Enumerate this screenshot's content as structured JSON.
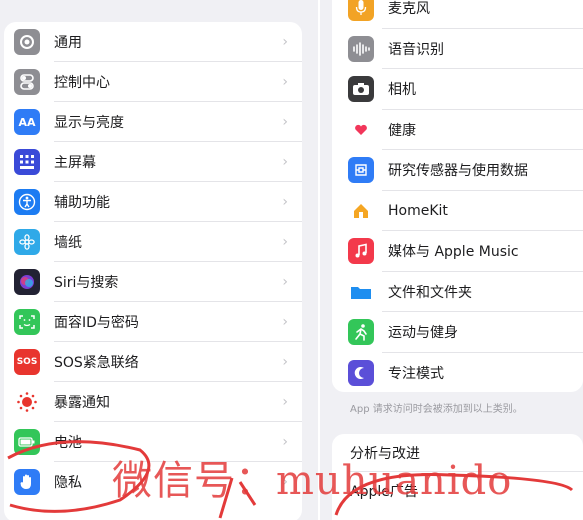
{
  "left_items": [
    {
      "label": "通用",
      "icon": "gear-icon",
      "color": "#8e8e93"
    },
    {
      "label": "控制中心",
      "icon": "toggle-icon",
      "color": "#8e8e93"
    },
    {
      "label": "显示与亮度",
      "icon": "aa-icon",
      "glyph": "AA",
      "color": "#2f7cf6"
    },
    {
      "label": "主屏幕",
      "icon": "grid-icon",
      "color": "#3a4ad8"
    },
    {
      "label": "辅助功能",
      "icon": "accessibility-icon",
      "color": "#1d7cf2"
    },
    {
      "label": "墙纸",
      "icon": "flower-icon",
      "color": "#2fa9e8"
    },
    {
      "label": "Siri与搜索",
      "icon": "siri-icon",
      "color": "#222233"
    },
    {
      "label": "面容ID与密码",
      "icon": "faceid-icon",
      "color": "#33c659"
    },
    {
      "label": "SOS紧急联络",
      "icon": "sos-icon",
      "glyph": "SOS",
      "color": "#e8352e"
    },
    {
      "label": "暴露通知",
      "icon": "exposure-icon",
      "color": "#ffffff"
    },
    {
      "label": "电池",
      "icon": "battery-icon",
      "color": "#33c659"
    },
    {
      "label": "隐私",
      "icon": "hand-icon",
      "color": "#2f7cf6"
    }
  ],
  "right_items": [
    {
      "label": "麦克风",
      "icon": "microphone-icon",
      "color": "#f2a325"
    },
    {
      "label": "语音识别",
      "icon": "waveform-icon",
      "color": "#8e8e93"
    },
    {
      "label": "相机",
      "icon": "camera-icon",
      "color": "#3a3a3c"
    },
    {
      "label": "健康",
      "icon": "heart-icon",
      "color": "#ffffff"
    },
    {
      "label": "研究传感器与使用数据",
      "icon": "research-icon",
      "color": "#2f7cf6"
    },
    {
      "label": "HomeKit",
      "icon": "home-icon",
      "color": "#f5a623"
    },
    {
      "label": "媒体与 Apple Music",
      "icon": "music-icon",
      "color": "#f3394b"
    },
    {
      "label": "文件和文件夹",
      "icon": "folder-icon",
      "color": "#1e8ef0"
    },
    {
      "label": "运动与健身",
      "icon": "fitness-icon",
      "color": "#33c659"
    },
    {
      "label": "专注模式",
      "icon": "moon-icon",
      "color": "#5b4fd8"
    }
  ],
  "right_footnote": "App 请求访问时会被添加到以上类别。",
  "right_group2": {
    "analytics": "分析与改进",
    "apple_ads": "Apple广告"
  },
  "watermark": "微信号：muhuanido"
}
